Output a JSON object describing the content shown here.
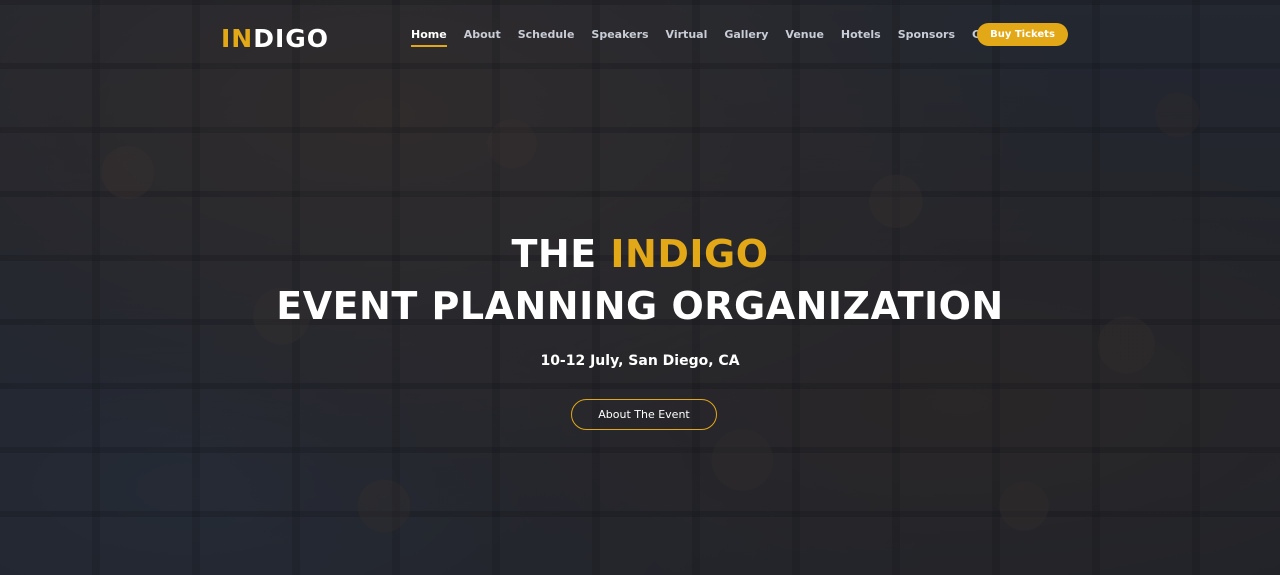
{
  "logo": {
    "part1": "IN",
    "part2": "DIGO"
  },
  "nav": {
    "items": [
      {
        "label": "Home"
      },
      {
        "label": "About"
      },
      {
        "label": "Schedule"
      },
      {
        "label": "Speakers"
      },
      {
        "label": "Virtual"
      },
      {
        "label": "Gallery"
      },
      {
        "label": "Venue"
      },
      {
        "label": "Hotels"
      },
      {
        "label": "Sponsors"
      },
      {
        "label": "Contact"
      }
    ],
    "buy_tickets": "Buy Tickets"
  },
  "hero": {
    "title_prefix": "THE",
    "title_accent": "INDIGO",
    "title_line2": "EVENT PLANNING ORGANIZATION",
    "subtitle": "10-12 July, San Diego, CA",
    "cta_label": "About The Event"
  },
  "colors": {
    "accent": "#e2a817",
    "text": "#ffffff",
    "nav_text": "#c8ccd6"
  }
}
